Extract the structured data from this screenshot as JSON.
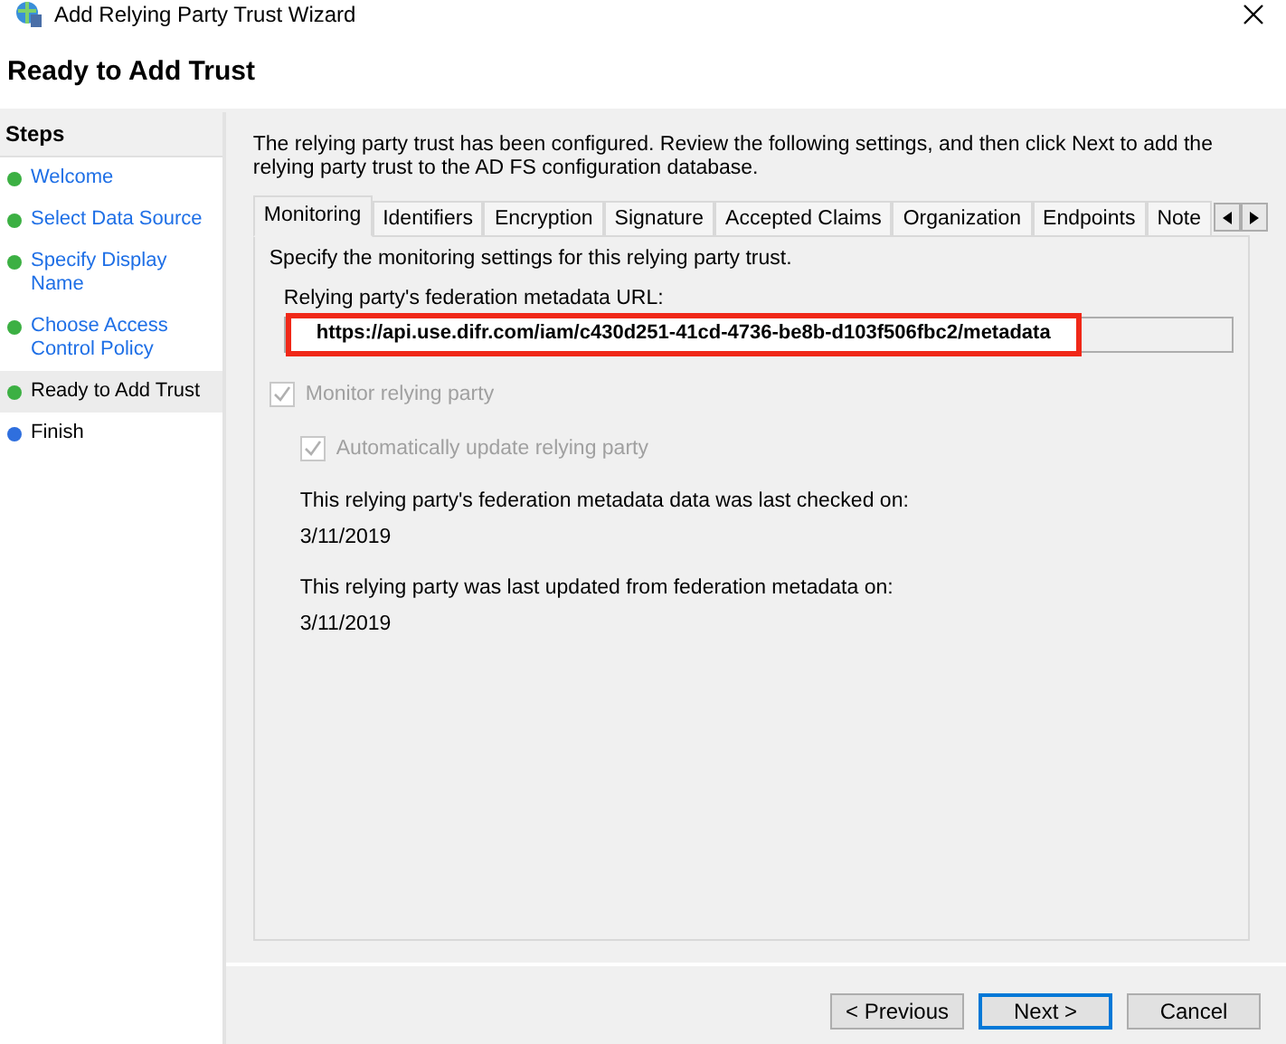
{
  "window": {
    "title": "Add Relying Party Trust Wizard"
  },
  "page_title": "Ready to Add Trust",
  "steps": {
    "heading": "Steps",
    "items": [
      {
        "label": "Welcome",
        "selected": false,
        "color": "#3cb043",
        "link": true
      },
      {
        "label": "Select Data Source",
        "selected": false,
        "color": "#3cb043",
        "link": true
      },
      {
        "label": "Specify Display Name",
        "selected": false,
        "color": "#3cb043",
        "link": true
      },
      {
        "label": "Choose Access Control Policy",
        "selected": false,
        "color": "#3cb043",
        "link": true
      },
      {
        "label": "Ready to Add Trust",
        "selected": true,
        "color": "#3cb043",
        "link": false
      },
      {
        "label": "Finish",
        "selected": false,
        "color": "#2f6fde",
        "link": false
      }
    ]
  },
  "intro": "The relying party trust has been configured. Review the following settings, and then click Next to add the relying party trust to the AD FS configuration database.",
  "tabs": [
    {
      "label": "Monitoring",
      "selected": true
    },
    {
      "label": "Identifiers",
      "selected": false
    },
    {
      "label": "Encryption",
      "selected": false
    },
    {
      "label": "Signature",
      "selected": false
    },
    {
      "label": "Accepted Claims",
      "selected": false
    },
    {
      "label": "Organization",
      "selected": false
    },
    {
      "label": "Endpoints",
      "selected": false
    },
    {
      "label": "Note",
      "selected": false
    }
  ],
  "panel": {
    "description": "Specify the monitoring settings for this relying party trust.",
    "url_label": "Relying party's federation metadata URL:",
    "url_value": "https://api.use.difr.com/iam/c430d251-41cd-4736-be8b-d103f506fbc2/metadata",
    "url_highlighted": true,
    "checkboxes": [
      {
        "label": "Monitor relying party",
        "checked": true,
        "disabled": true
      },
      {
        "label": "Automatically update relying party",
        "checked": true,
        "disabled": true
      }
    ],
    "info": [
      {
        "label": "This relying party's federation metadata data was last checked on:",
        "value": "3/11/2019"
      },
      {
        "label": "This relying party was last updated from federation metadata on:",
        "value": "3/11/2019"
      }
    ]
  },
  "buttons": [
    {
      "label": "< Previous",
      "selected": false
    },
    {
      "label": "Next >",
      "selected": true
    },
    {
      "label": "Cancel",
      "selected": false
    }
  ]
}
